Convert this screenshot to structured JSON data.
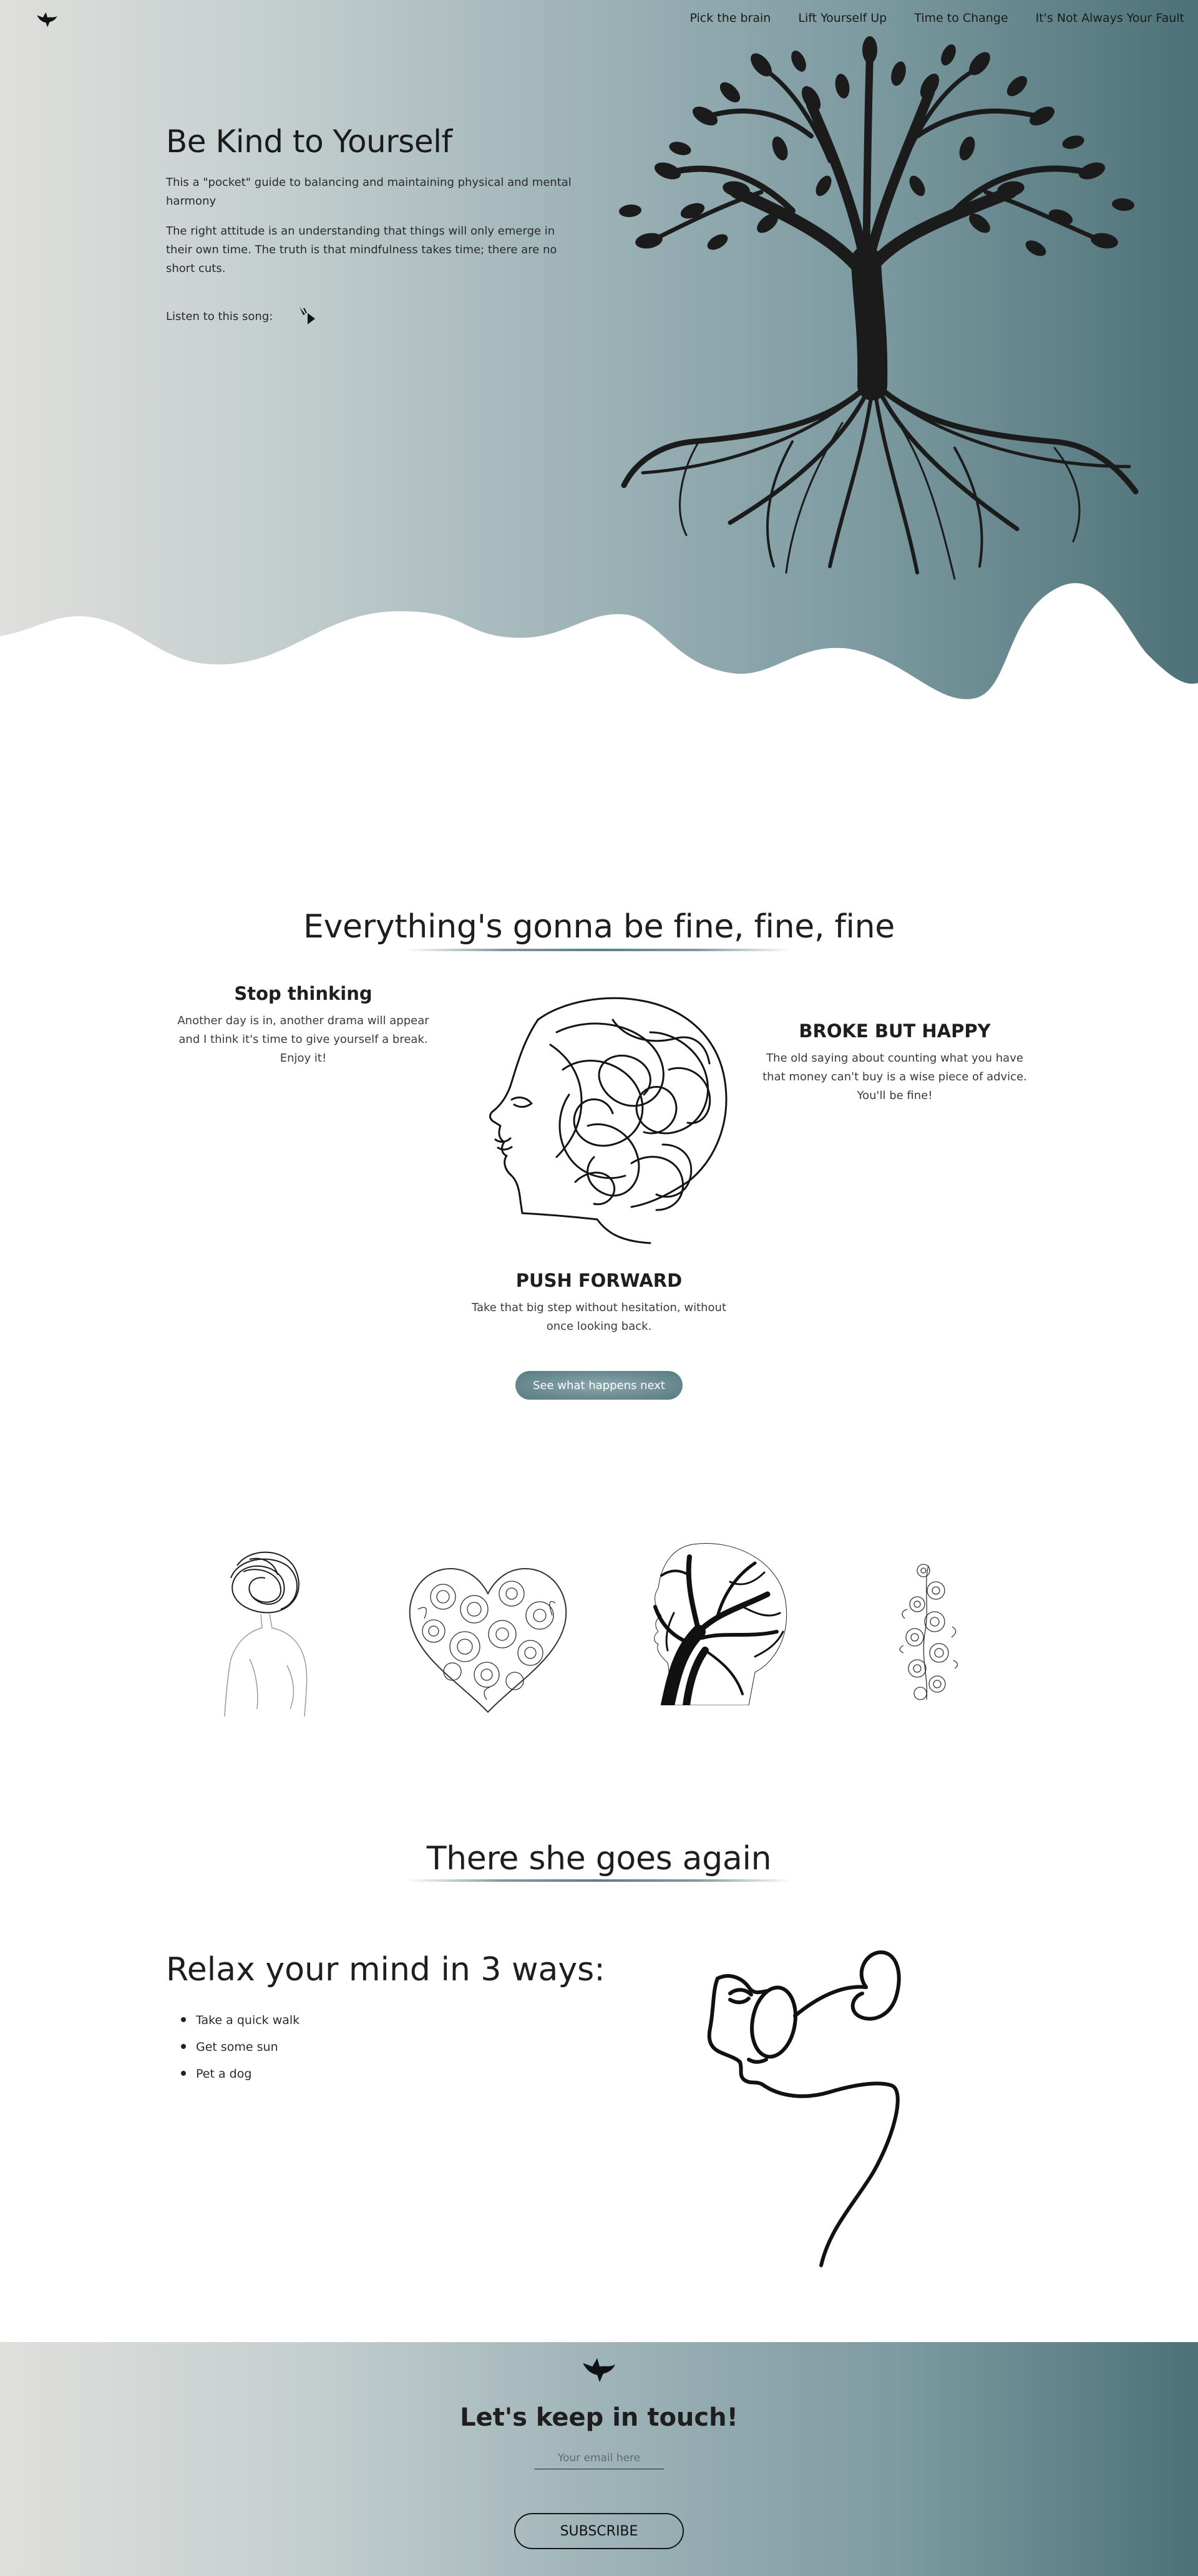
{
  "nav": {
    "logo_icon": "bird-icon",
    "items": [
      {
        "label": "Pick the brain"
      },
      {
        "label": "Lift Yourself Up"
      },
      {
        "label": "Time to Change"
      },
      {
        "label": "It's Not Always Your Fault"
      }
    ]
  },
  "hero": {
    "title": "Be Kind to Yourself",
    "paragraph_1": "This a \"pocket\" guide to balancing and maintaining physical and mental harmony",
    "paragraph_2": "The right attitude is an understanding that things will only emerge in their own time. The truth is that mindfulness takes time; there are no short cuts.",
    "song_label": "Listen to this song:",
    "play_icon": "play-cursor-icon",
    "image": "tree-with-roots-illustration"
  },
  "section_fine": {
    "title": "Everything's gonna be fine, fine, fine",
    "cards": [
      {
        "title": "Stop thinking",
        "text": "Another day is in, another drama will appear and I think it's time to give yourself a break. Enjoy it!"
      },
      {
        "title": "BROKE BUT HAPPY",
        "text": "The old saying about counting what you have that money can't buy is a wise piece of advice. You'll be fine!"
      },
      {
        "title": "PUSH FORWARD",
        "text": "Take that big step without hesitation, without once looking back."
      }
    ],
    "image": "scribbled-head-profile-illustration",
    "cta_label": "See what happens next"
  },
  "gallery": {
    "images": [
      "scribble-head-figure",
      "floral-heart",
      "tree-head-silhouette",
      "flower-vine"
    ]
  },
  "section_relax": {
    "title": "There she goes again",
    "subtitle": "Relax your mind in 3 ways:",
    "items": [
      "Take a quick walk",
      "Get some sun",
      "Pet a dog"
    ],
    "image": "line-art-face-with-glasses"
  },
  "footer": {
    "logo_icon": "bird-icon",
    "title": "Let's keep in touch!",
    "email_placeholder": "Your email here",
    "subscribe_label": "SUBSCRIBE"
  },
  "colors": {
    "gradient_light": "#dfdfdc",
    "gradient_mid": "#9fb4b8",
    "gradient_dark": "#4d7178",
    "cta": "#6b8b92",
    "text": "#1e1e1e"
  }
}
